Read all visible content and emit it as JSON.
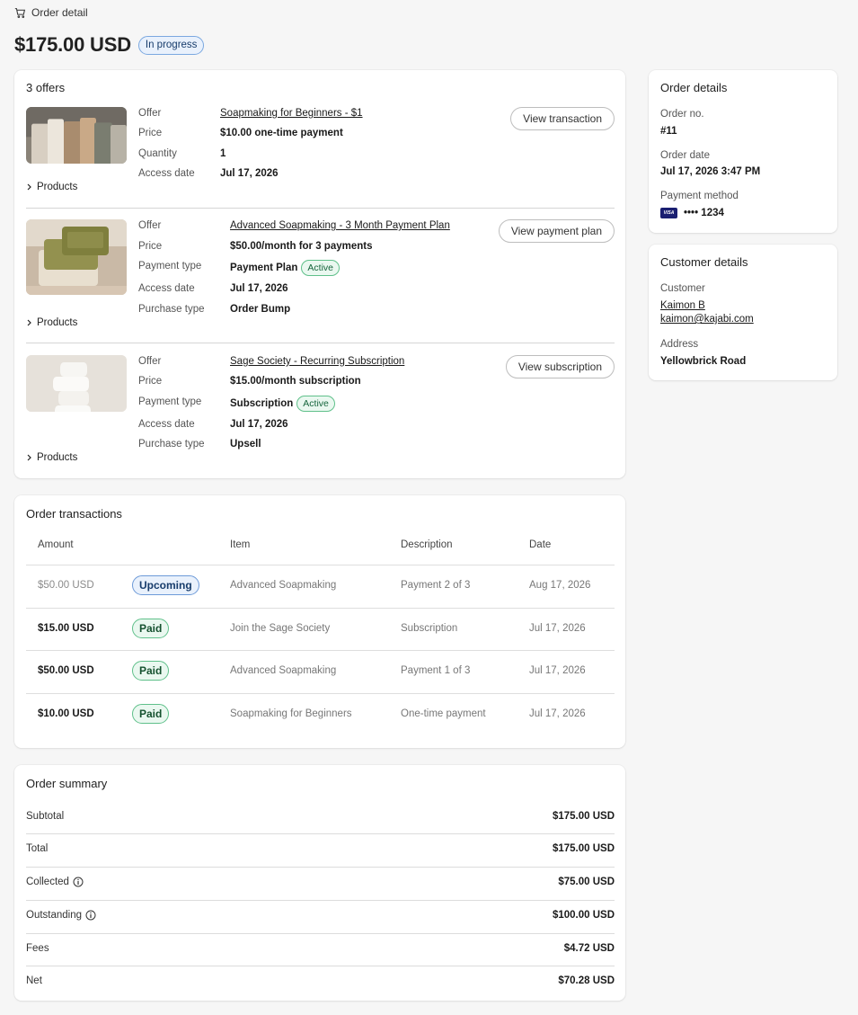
{
  "breadcrumb": {
    "label": "Order detail"
  },
  "header": {
    "amount": "$175.00 USD",
    "status": "In progress"
  },
  "offers": {
    "title": "3 offers",
    "items": [
      {
        "offer_label": "Offer",
        "offer": "Soapmaking for Beginners - $1",
        "price_label": "Price",
        "price": "$10.00 one-time payment",
        "r3_label": "Quantity",
        "r3": "1",
        "access_label": "Access date",
        "access": "Jul 17, 2026",
        "button": "View transaction",
        "products": "Products"
      },
      {
        "offer_label": "Offer",
        "offer": "Advanced Soapmaking - 3 Month Payment Plan",
        "price_label": "Price",
        "price": "$50.00/month for 3 payments",
        "r3_label": "Payment type",
        "r3": "Payment Plan",
        "r3_badge": "Active",
        "access_label": "Access date",
        "access": "Jul 17, 2026",
        "purchase_label": "Purchase type",
        "purchase": "Order Bump",
        "button": "View payment plan",
        "products": "Products"
      },
      {
        "offer_label": "Offer",
        "offer": "Sage Society - Recurring Subscription",
        "price_label": "Price",
        "price": "$15.00/month subscription",
        "r3_label": "Payment type",
        "r3": "Subscription",
        "r3_badge": "Active",
        "access_label": "Access date",
        "access": "Jul 17, 2026",
        "purchase_label": "Purchase type",
        "purchase": "Upsell",
        "button": "View subscription",
        "products": "Products"
      }
    ]
  },
  "transactions": {
    "title": "Order transactions",
    "columns": [
      "Amount",
      "Item",
      "Description",
      "Date"
    ],
    "rows": [
      {
        "amount": "$50.00 USD",
        "status": "Upcoming",
        "item": "Advanced Soapmaking",
        "description": "Payment 2 of 3",
        "date": "Aug 17, 2026"
      },
      {
        "amount": "$15.00 USD",
        "status": "Paid",
        "item": "Join the Sage Society",
        "description": "Subscription",
        "date": "Jul 17, 2026"
      },
      {
        "amount": "$50.00 USD",
        "status": "Paid",
        "item": "Advanced Soapmaking",
        "description": "Payment 1 of 3",
        "date": "Jul 17, 2026"
      },
      {
        "amount": "$10.00 USD",
        "status": "Paid",
        "item": "Soapmaking for Beginners",
        "description": "One-time payment",
        "date": "Jul 17, 2026"
      }
    ]
  },
  "summary": {
    "title": "Order summary",
    "rows": [
      {
        "label": "Subtotal",
        "value": "$175.00 USD"
      },
      {
        "label": "Total",
        "value": "$175.00 USD"
      },
      {
        "label": "Collected",
        "value": "$75.00 USD"
      },
      {
        "label": "Outstanding",
        "value": "$100.00 USD"
      },
      {
        "label": "Fees",
        "value": "$4.72 USD"
      },
      {
        "label": "Net",
        "value": "$70.28 USD"
      }
    ]
  },
  "order_details": {
    "title": "Order details",
    "order_no_label": "Order no.",
    "order_no": "#11",
    "order_date_label": "Order date",
    "order_date": "Jul 17, 2026 3:47 PM",
    "payment_label": "Payment method",
    "card_brand": "VISA",
    "card_number": "•••• 1234"
  },
  "customer_details": {
    "title": "Customer details",
    "customer_label": "Customer",
    "name": "Kaimon B",
    "email": "kaimon@kajabi.com",
    "address_label": "Address",
    "address": "Yellowbrick Road"
  },
  "colors": {
    "page_bg": "#f6f6f6",
    "card_bg": "#ffffff",
    "paid_green": "#5fc08a",
    "upcoming_blue": "#6d9ad8"
  }
}
